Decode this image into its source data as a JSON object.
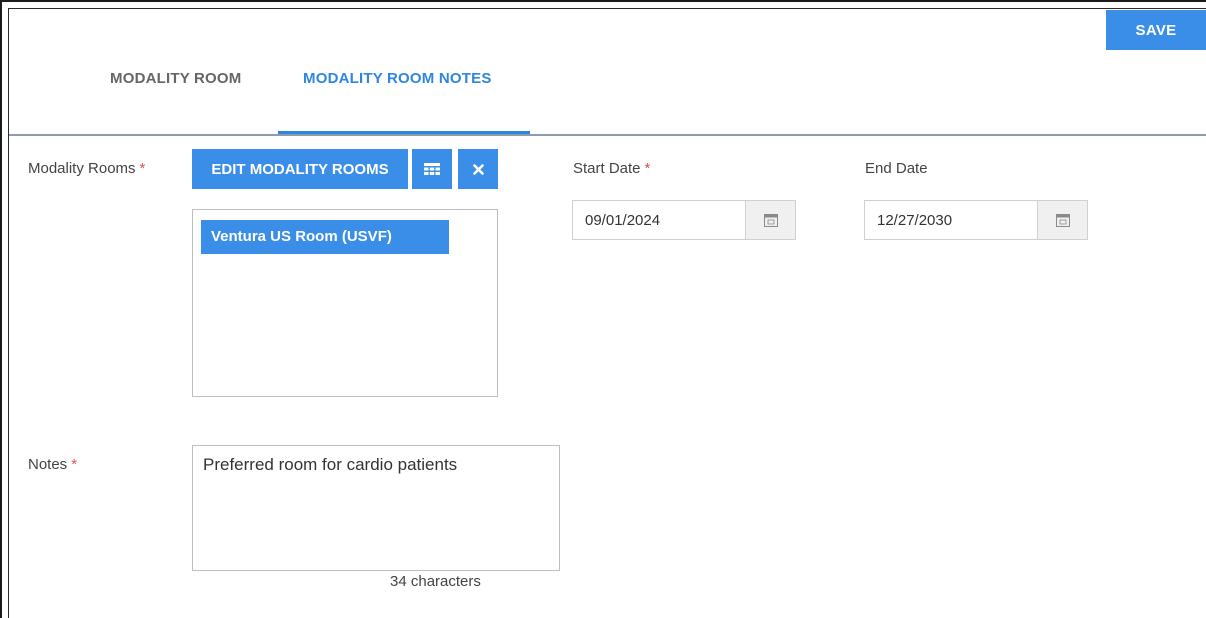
{
  "toolbar": {
    "save_label": "SAVE"
  },
  "tabs": [
    {
      "label": "MODALITY ROOM",
      "active": false
    },
    {
      "label": "MODALITY ROOM NOTES",
      "active": true
    }
  ],
  "form": {
    "modality_rooms_label": "Modality Rooms",
    "required_marker": "*",
    "edit_button_label": "EDIT MODALITY ROOMS",
    "selected_rooms": [
      "Ventura US Room (USVF)"
    ],
    "start_date_label": "Start Date",
    "start_date_value": "09/01/2024",
    "end_date_label": "End Date",
    "end_date_value": "12/27/2030",
    "notes_label": "Notes",
    "notes_value": "Preferred room for cardio patients",
    "char_count": "34 characters"
  },
  "colors": {
    "accent": "#3b8ee8",
    "active_tab": "#2f86e0",
    "inactive_tab": "#666666",
    "required": "#d9534f"
  },
  "icons": [
    "grid-icon",
    "close-icon",
    "calendar-icon"
  ]
}
